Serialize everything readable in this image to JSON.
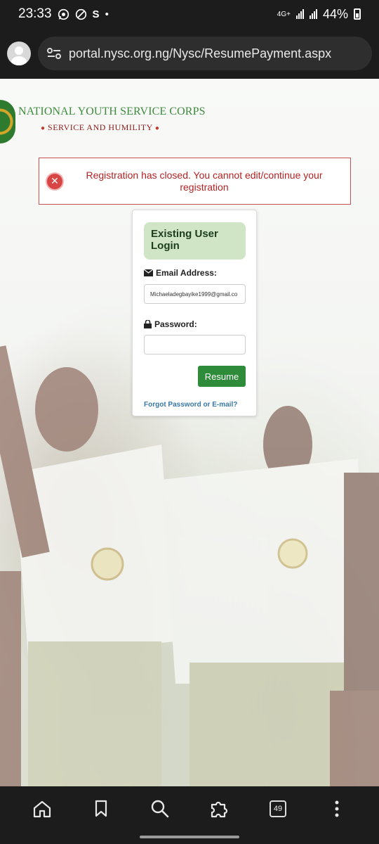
{
  "status_bar": {
    "time": "23:33",
    "network": "4G+",
    "battery": "44%"
  },
  "browser": {
    "url": "portal.nysc.org.ng/Nysc/ResumePayment.aspx",
    "tab_count": "49"
  },
  "header": {
    "org_name": "NATIONAL YOUTH SERVICE CORPS",
    "motto": "SERVICE AND HUMILITY"
  },
  "alert": {
    "message": "Registration has closed. You cannot edit/continue your registration",
    "color": "#b22222"
  },
  "login": {
    "title": "Existing User Login",
    "email_label": "Email Address:",
    "email_value": "Michaeladegbayike1999@gmail.co",
    "password_label": "Password:",
    "password_value": "",
    "submit_label": "Resume",
    "forgot_link": "Forgot Password or E-mail?",
    "button_color": "#2e8b3a"
  },
  "nav_icons": [
    "home-icon",
    "bookmark-icon",
    "search-icon",
    "extensions-icon",
    "tabs-icon",
    "more-icon"
  ]
}
